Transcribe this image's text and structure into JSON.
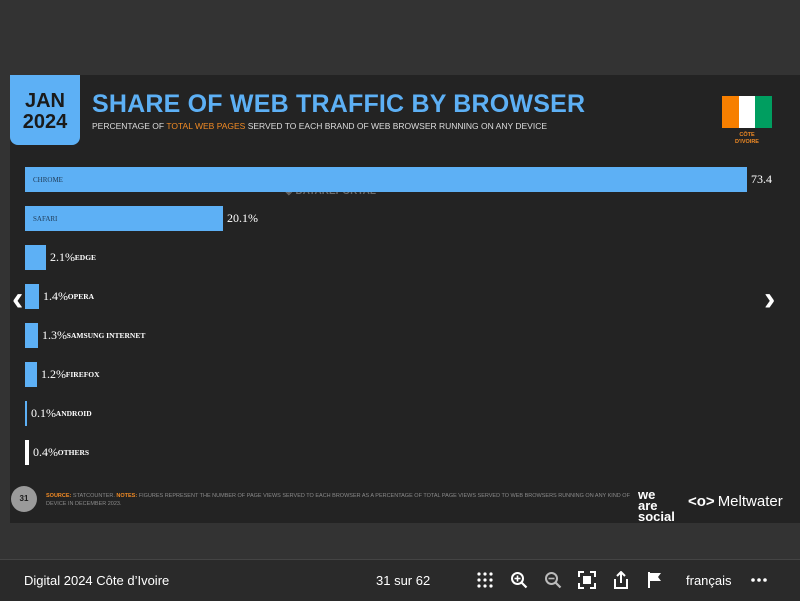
{
  "slide": {
    "badge": {
      "month": "JAN",
      "year": "2024"
    },
    "title": "SHARE OF WEB TRAFFIC BY BROWSER",
    "subtitle_before": "PERCENTAGE OF ",
    "subtitle_highlight": "TOTAL WEB PAGES",
    "subtitle_after": " SERVED TO EACH BRAND OF WEB BROWSER RUNNING ON ANY DEVICE",
    "flag_label_line1": "CÔTE",
    "flag_label_line2": "D'IVOIRE",
    "watermark": "DATAREPORTAL",
    "page_number": "31",
    "source_label": "SOURCE:",
    "source_text": " STATCOUNTER. ",
    "notes_label": "NOTES:",
    "notes_text": " FIGURES REPRESENT THE NUMBER OF PAGE VIEWS SERVED TO EACH BROWSER AS A PERCENTAGE OF TOTAL PAGE VIEWS SERVED TO WEB BROWSERS RUNNING ON ANY KIND OF DEVICE IN DECEMBER 2023.",
    "brand_line1": "we",
    "brand_line2": "are",
    "brand_line3": "social",
    "brand_meltwater": "Meltwater"
  },
  "chart_data": {
    "type": "bar",
    "categories": [
      "CHROME",
      "SAFARI",
      "EDGE",
      "OPERA",
      "SAMSUNG INTERNET",
      "FIREFOX",
      "ANDROID",
      "OTHERS"
    ],
    "values": [
      73.4,
      20.1,
      2.1,
      1.4,
      1.3,
      1.2,
      0.1,
      0.4
    ],
    "value_labels": [
      "73.4",
      "20.1%",
      "2.1%",
      "1.4%",
      "1.3%",
      "1.2%",
      "0.1%",
      "0.4%"
    ],
    "title": "SHARE OF WEB TRAFFIC BY BROWSER",
    "xlabel": "",
    "ylabel": "",
    "colors": [
      "#5db0f5",
      "#5db0f5",
      "#5db0f5",
      "#5db0f5",
      "#5db0f5",
      "#5db0f5",
      "#5db0f5",
      "#ffffff"
    ]
  },
  "colors": {
    "accent": "#5db0f5",
    "highlight": "#f08a24",
    "flag_orange": "#f77f00",
    "flag_white": "#ffffff",
    "flag_green": "#009e60"
  },
  "footer": {
    "doc_title": "Digital 2024 Côte d’Ivoire",
    "pager": "31 sur 62",
    "language": "français",
    "icons": [
      "grid-icon",
      "zoom-in-icon",
      "zoom-out-icon",
      "fullscreen-icon",
      "share-icon",
      "flag-icon",
      "more-icon"
    ]
  },
  "nav": {
    "prev": "‹",
    "next": "›"
  }
}
